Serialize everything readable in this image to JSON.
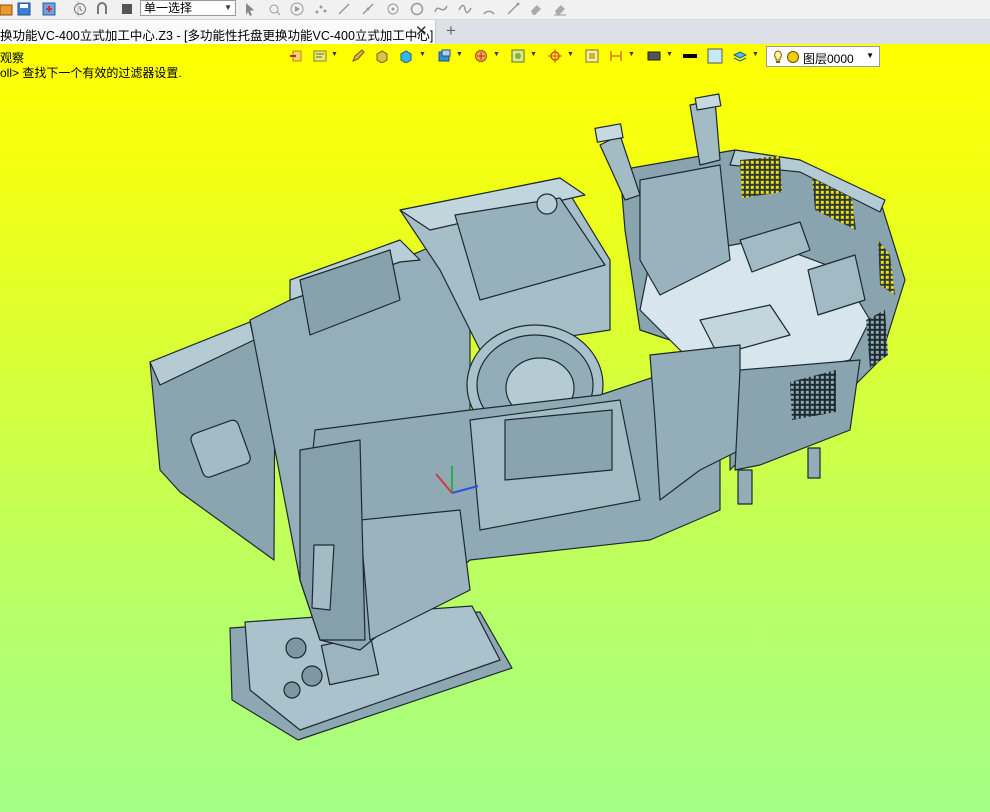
{
  "toolbar": {
    "filter_value": "单一选择"
  },
  "tab": {
    "title": "换功能VC-400立式加工中心.Z3 - [多功能性托盘更换功能VC-400立式加工中心]",
    "close": "✕",
    "new": "+"
  },
  "viewport": {
    "panel_label": "观察",
    "status": "oll> 查找下一个有效的过滤器设置."
  },
  "view_toolbar": {
    "layer": "图层0000"
  },
  "colors": {
    "bg_top": "#ffff00",
    "bg_bottom": "#a4ff86",
    "model_face": "#9fb9c4",
    "model_edge": "#1c2a30",
    "vent_yellow": "#f2e000"
  }
}
